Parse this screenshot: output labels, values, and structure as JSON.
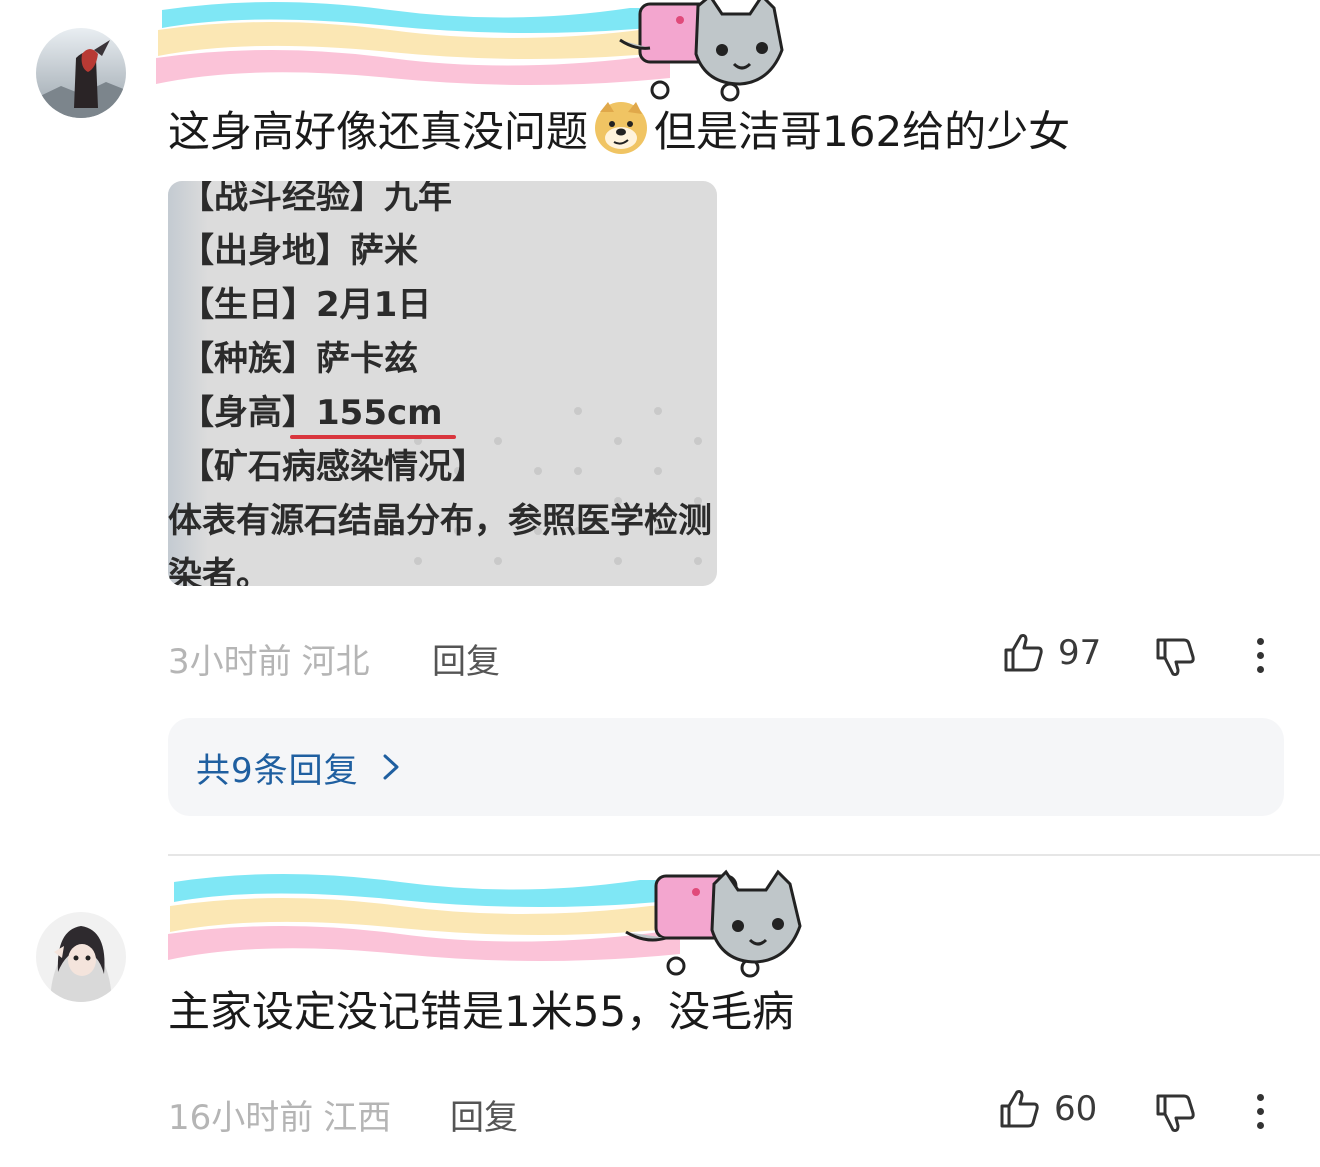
{
  "comments": [
    {
      "text_before_emoji": "这身高好像还真没问题",
      "emoji": "doge-emoji",
      "text_after_emoji": "但是洁哥162给的少女",
      "attached_image": {
        "lines": [
          "【战斗经验】九年",
          "【出身地】萨米",
          "【生日】2月1日",
          "【种族】萨卡兹",
          "【身高】155cm",
          "【矿石病感染情况】",
          "体表有源石结晶分布，参照医学检测",
          "染者。"
        ]
      },
      "time": "3小时前",
      "location": "河北",
      "reply_label": "回复",
      "like_count": "97",
      "replies_summary": "共9条回复"
    },
    {
      "text": "主家设定没记错是1米55，没毛病",
      "time": "16小时前",
      "location": "江西",
      "reply_label": "回复",
      "like_count": "60"
    }
  ],
  "icons": {
    "like": "thumbs-up-icon",
    "dislike": "thumbs-down-icon",
    "more": "more-vertical-icon",
    "chevron": "chevron-right-icon"
  },
  "colors": {
    "link_blue": "#1f5fa0",
    "meta_gray": "#b5b5b5",
    "highlight_red": "#d9363e"
  }
}
